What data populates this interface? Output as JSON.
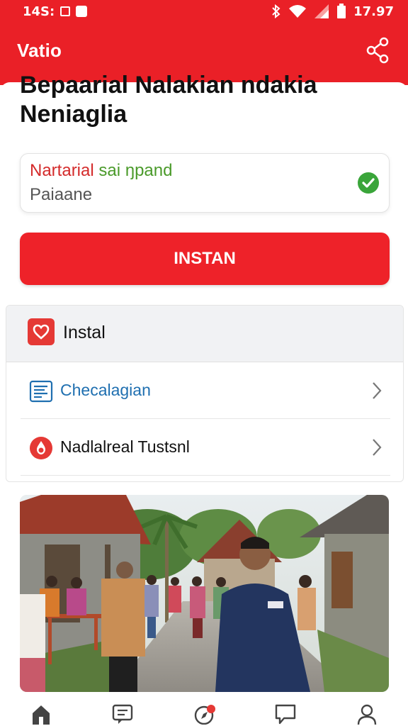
{
  "status_bar": {
    "time": "14S:",
    "clock": "17.97"
  },
  "app_bar": {
    "title": "Vatio",
    "share_icon": "share-icon"
  },
  "headline": "Bepaarial Nalakian ndakia Neniaglia",
  "status_card": {
    "line_red": "Nartarial",
    "line_green": "sai ŋpand",
    "subtitle": "Paiaane",
    "status_icon": "check-circle-icon"
  },
  "install_button": {
    "label": "INSTAN"
  },
  "panel": {
    "title": "Instal",
    "title_icon": "heart-icon",
    "items": [
      {
        "label": "Checalagian",
        "icon": "list-document-icon"
      },
      {
        "label": "Nadlalreal Tustsnl",
        "icon": "drop-icon"
      }
    ]
  },
  "photo": {
    "description_icon": "village-street-photo"
  },
  "bottom_nav": {
    "items": [
      "home-icon",
      "chat-list-icon",
      "compass-icon",
      "message-icon",
      "profile-icon"
    ]
  },
  "colors": {
    "brand_red": "#ea2027",
    "button_red": "#ee2229",
    "link_blue": "#1f6fb0",
    "success_green": "#3aa53a"
  }
}
